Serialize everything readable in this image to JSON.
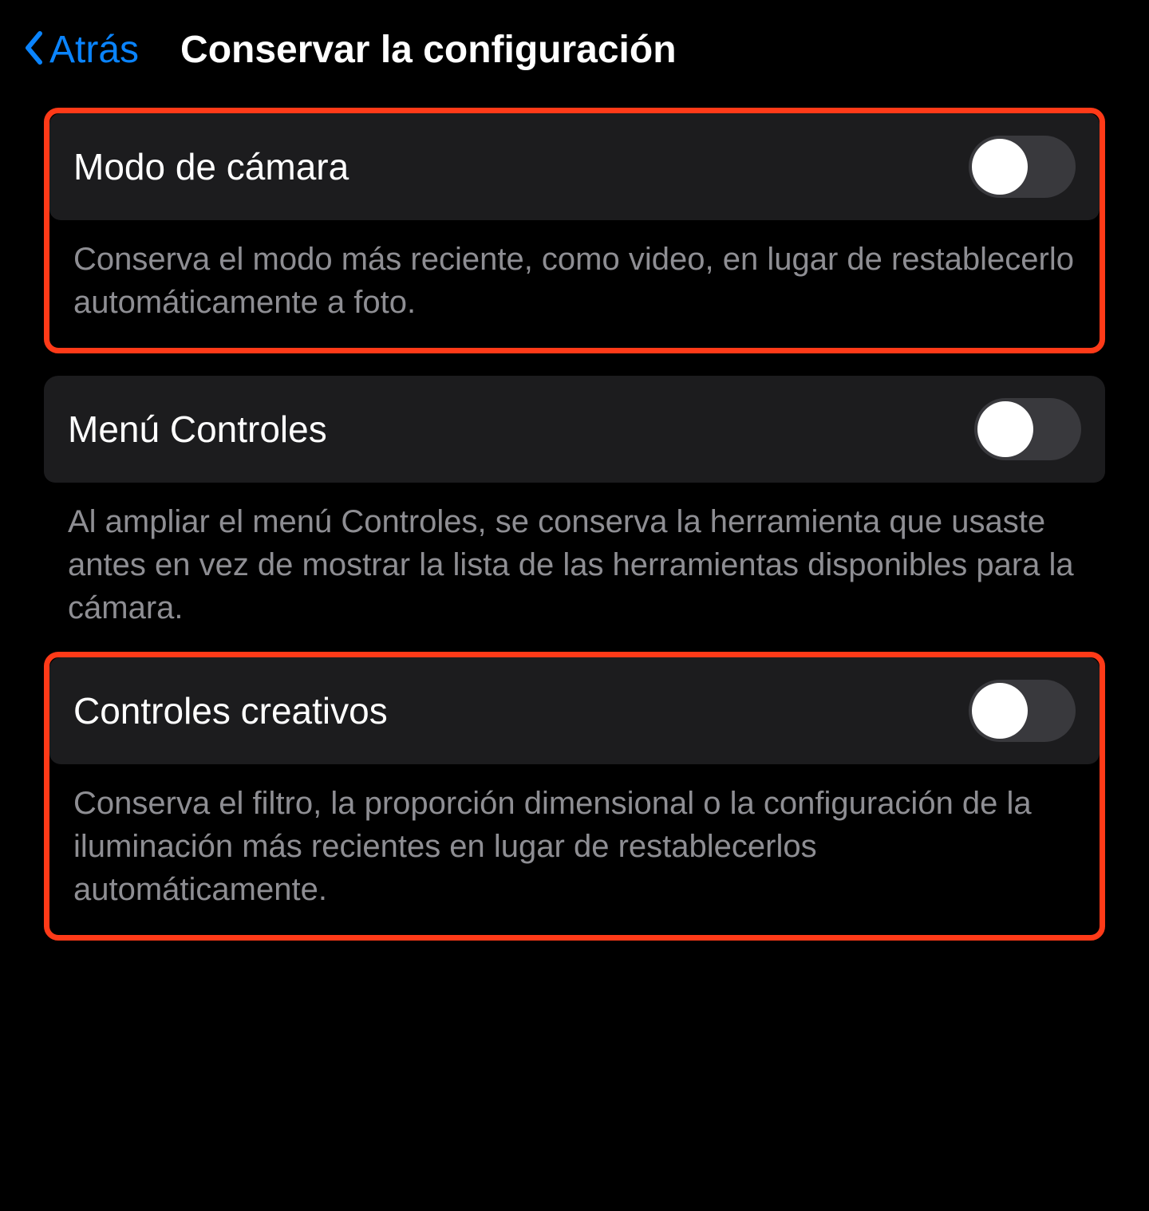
{
  "header": {
    "back_label": "Atrás",
    "title": "Conservar la configuración"
  },
  "settings": [
    {
      "label": "Modo de cámara",
      "description": "Conserva el modo más reciente, como video, en lugar de restablecerlo automáticamente a foto.",
      "on": false,
      "highlighted": true
    },
    {
      "label": "Menú Controles",
      "description": "Al ampliar el menú Controles, se conserva la herramienta que usaste antes en vez de mostrar la lista de las herramientas disponibles para la cámara.",
      "on": false,
      "highlighted": false
    },
    {
      "label": "Controles creativos",
      "description": "Conserva el filtro, la proporción dimensional o la configuración de la iluminación más recientes en lugar de restablecerlos automáticamente.",
      "on": false,
      "highlighted": true
    }
  ]
}
